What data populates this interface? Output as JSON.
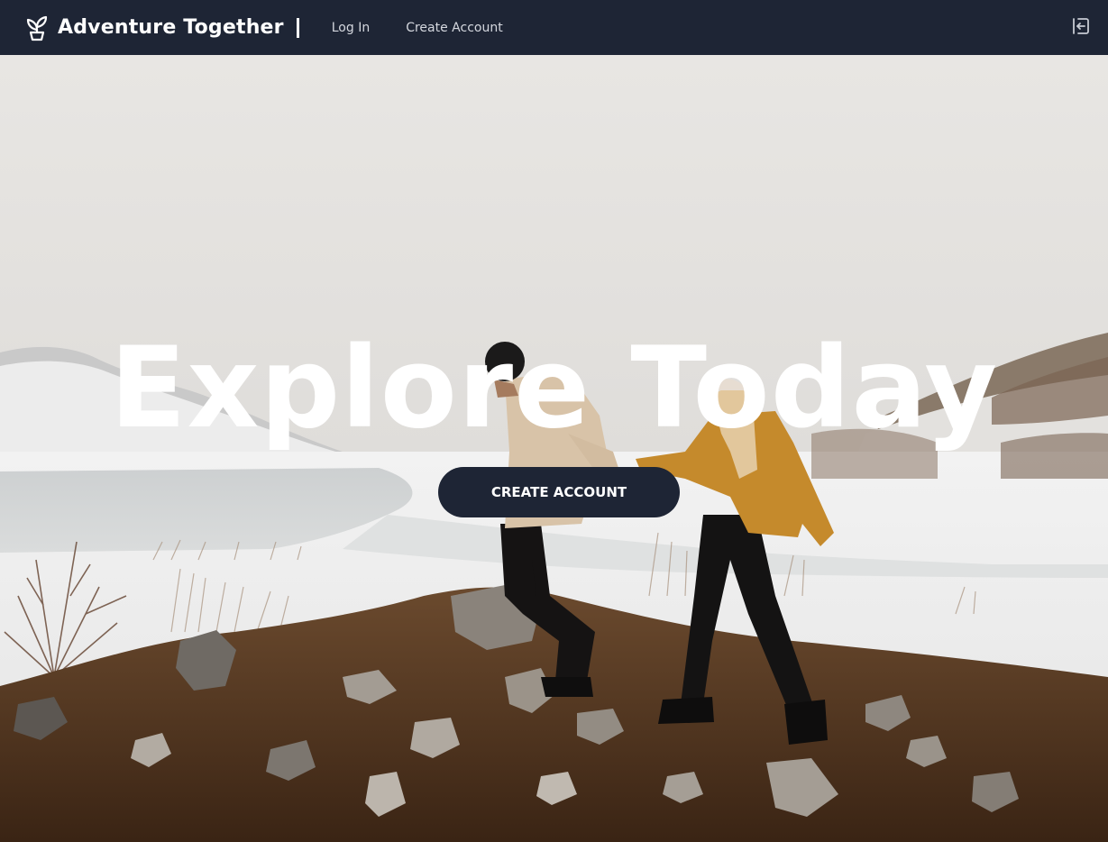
{
  "navbar": {
    "brand_title": "Adventure Together",
    "brand_icon": "sprout-icon",
    "links": {
      "login": "Log In",
      "create_account": "Create Account"
    },
    "signin_icon": "sign-in-icon"
  },
  "hero": {
    "title": "Explore Today",
    "cta_label": "CREATE ACCOUNT"
  },
  "colors": {
    "navbar_bg": "#1e2535",
    "cta_bg": "#1e2535",
    "text_light": "#ffffff",
    "nav_link": "#d4d7de"
  }
}
